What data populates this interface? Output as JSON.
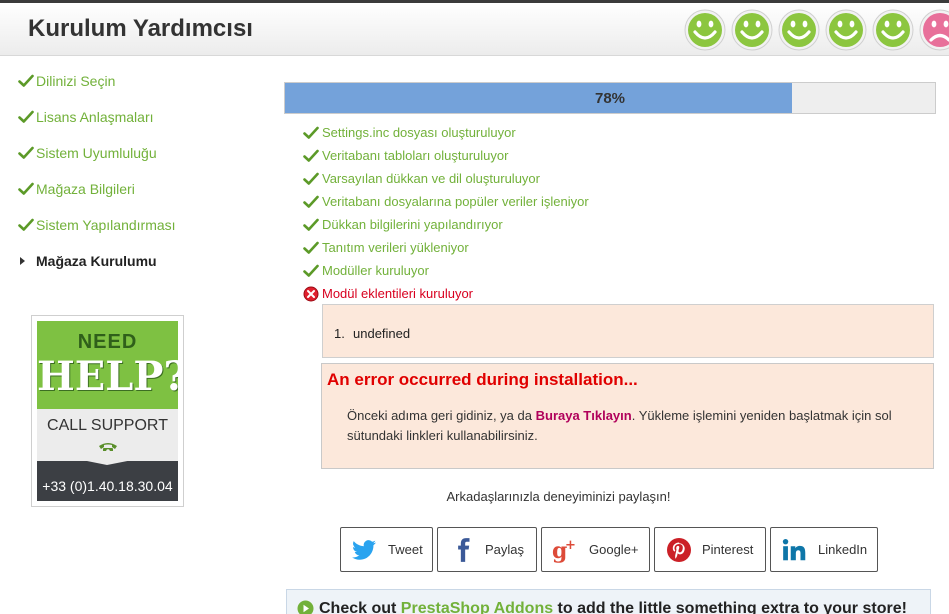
{
  "header": {
    "title": "Kurulum Yardımcısı",
    "smileys": [
      {
        "mood": "happy",
        "color": "#8cc63f"
      },
      {
        "mood": "happy",
        "color": "#8cc63f"
      },
      {
        "mood": "happy",
        "color": "#8cc63f"
      },
      {
        "mood": "happy",
        "color": "#8cc63f"
      },
      {
        "mood": "happy",
        "color": "#8cc63f"
      },
      {
        "mood": "sad",
        "color": "#e8709a"
      }
    ]
  },
  "sidebar": {
    "steps": [
      {
        "label": "Dilinizi Seçin",
        "state": "done",
        "icon": "check-icon"
      },
      {
        "label": "Lisans Anlaşmaları",
        "state": "done",
        "icon": "check-icon"
      },
      {
        "label": "Sistem Uyumluluğu",
        "state": "done",
        "icon": "check-icon"
      },
      {
        "label": "Mağaza Bilgileri",
        "state": "done",
        "icon": "check-icon"
      },
      {
        "label": "Sistem Yapılandırması",
        "state": "done",
        "icon": "check-icon"
      },
      {
        "label": "Mağaza Kurulumu",
        "state": "current",
        "icon": "arrow-right-icon"
      }
    ],
    "help": {
      "need": "NEED",
      "help": "HELP?",
      "call": "CALL SUPPORT",
      "phone": "+33 (0)1.40.18.30.04",
      "icon": "phone-icon"
    }
  },
  "progress": {
    "text": "78%",
    "fraction": 0.78
  },
  "tasks": [
    {
      "label": "Settings.inc dosyası oluşturuluyor",
      "status": "ok"
    },
    {
      "label": "Veritabanı tabloları oluşturuluyor",
      "status": "ok"
    },
    {
      "label": "Varsayılan dükkan ve dil oluşturuluyor",
      "status": "ok"
    },
    {
      "label": "Veritabanı dosyalarına popüler veriler işleniyor",
      "status": "ok"
    },
    {
      "label": "Dükkan bilgilerini yapılandırıyor",
      "status": "ok"
    },
    {
      "label": "Tanıtım verileri yükleniyor",
      "status": "ok"
    },
    {
      "label": "Modüller kuruluyor",
      "status": "ok"
    },
    {
      "label": "Modül eklentileri kuruluyor",
      "status": "error"
    }
  ],
  "error_list": {
    "number": "1.",
    "value": "undefined"
  },
  "error_box": {
    "title": "An error occurred during installation...",
    "text_before": "Önceki adıma geri gidiniz, ya da ",
    "link": "Buraya Tıklayın",
    "text_after": ". Yükleme işlemini yeniden başlatmak için sol sütundaki linkleri kullanabilirsiniz."
  },
  "share": {
    "title": "Arkadaşlarınızla deneyiminizi paylaşın!",
    "buttons": [
      {
        "label": "Tweet",
        "icon": "twitter-icon",
        "color": "#2aa3ef"
      },
      {
        "label": "Paylaş",
        "icon": "facebook-icon",
        "color": "#3b5998"
      },
      {
        "label": "Google+",
        "icon": "google-plus-icon",
        "color": "#dd4b39"
      },
      {
        "label": "Pinterest",
        "icon": "pinterest-icon",
        "color": "#cb2027"
      },
      {
        "label": "LinkedIn",
        "icon": "linkedin-icon",
        "color": "#0e76a8"
      }
    ]
  },
  "addons": {
    "before": "Check out ",
    "link": "PrestaShop Addons",
    "after": " to add the little something extra to your store!",
    "icon": "play-circle-icon"
  },
  "colors": {
    "accent_green": "#72b13a",
    "progress_fill": "#74a2da",
    "error_red": "#e00000",
    "error_bg": "#fce8db",
    "link_magenta": "#b0005b"
  }
}
